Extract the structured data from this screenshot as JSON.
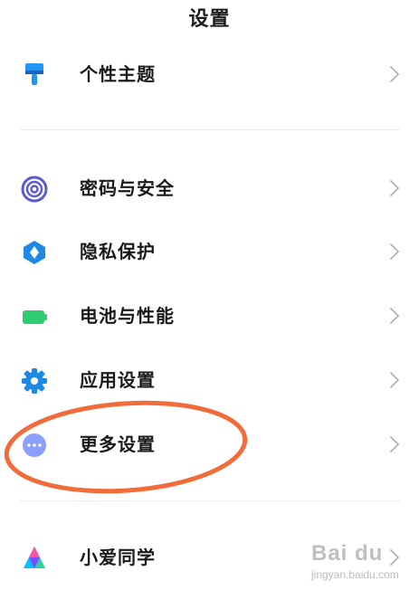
{
  "header": {
    "title": "设置"
  },
  "settings": {
    "items": [
      {
        "label": "个性主题",
        "icon": "paint-brush-icon",
        "color": "#2196F3"
      },
      {
        "label": "密码与安全",
        "icon": "fingerprint-icon",
        "color": "#5C5BD0"
      },
      {
        "label": "隐私保护",
        "icon": "privacy-shield-icon",
        "color": "#1E88E5"
      },
      {
        "label": "电池与性能",
        "icon": "battery-icon",
        "color": "#2ECC71"
      },
      {
        "label": "应用设置",
        "icon": "gear-icon",
        "color": "#1E88E5"
      },
      {
        "label": "更多设置",
        "icon": "more-dots-icon",
        "color": "#8C9EFF"
      },
      {
        "label": "小爱同学",
        "icon": "xiaoai-assistant-icon",
        "color": "#7C4DFF"
      }
    ]
  },
  "annotation": {
    "color": "#F26B3A"
  },
  "watermark": {
    "logo": "Bai du",
    "sub": "jingyan.baidu.com"
  }
}
